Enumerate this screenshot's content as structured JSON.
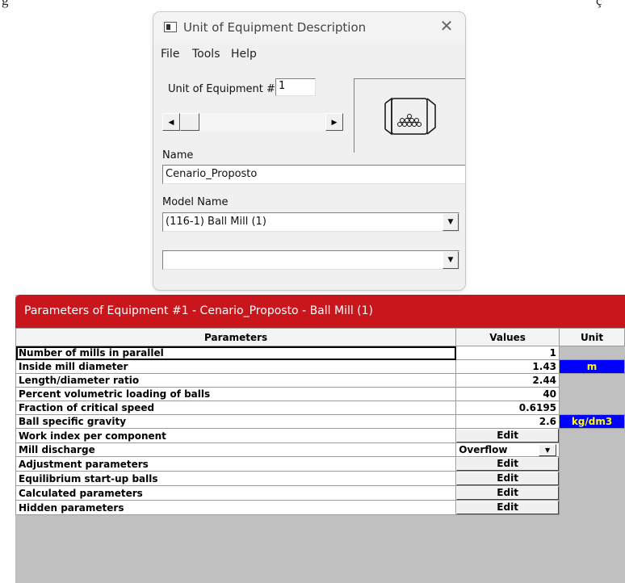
{
  "dialog1": {
    "title": "Unit of Equipment Description",
    "menu": [
      "File",
      "Tools",
      "Help"
    ],
    "unit_label": "Unit of Equipment #",
    "unit_number": "1",
    "name_label": "Name",
    "name_value": "Cenario_Proposto",
    "model_label": "Model Name",
    "model_value": "(116-1)  Ball Mill (1)",
    "extra_combo_value": "",
    "icons": {
      "app": "window-icon",
      "close": "close-icon",
      "equipment": "ball-mill-icon"
    }
  },
  "dialog2": {
    "title": "Parameters of Equipment #1 - Cenario_Proposto - Ball Mill (1)",
    "title_color": "#c8161c",
    "columns": [
      "Parameters",
      "Values",
      "Unit"
    ],
    "rows": [
      {
        "name": "Number of mills in parallel",
        "value": "1",
        "unit": ""
      },
      {
        "name": "Inside mill diameter",
        "value": "1.43",
        "unit": "m"
      },
      {
        "name": "Length/diameter ratio",
        "value": "2.44",
        "unit": ""
      },
      {
        "name": "Percent volumetric loading of balls",
        "value": "40",
        "unit": ""
      },
      {
        "name": "Fraction of critical speed",
        "value": "0.6195",
        "unit": ""
      },
      {
        "name": "Ball specific gravity",
        "value": "2.6",
        "unit": "kg/dm3"
      },
      {
        "name": "Work index per component",
        "value": "Edit",
        "unit": ""
      },
      {
        "name": "Mill discharge",
        "value": "Overflow",
        "unit": ""
      },
      {
        "name": "Adjustment parameters",
        "value": "Edit",
        "unit": ""
      },
      {
        "name": "Equilibrium start-up balls",
        "value": "Edit",
        "unit": ""
      },
      {
        "name": "Calculated parameters",
        "value": "Edit",
        "unit": ""
      },
      {
        "name": "Hidden parameters",
        "value": "Edit",
        "unit": ""
      }
    ],
    "unit_highlight_color": "#0000ff"
  }
}
